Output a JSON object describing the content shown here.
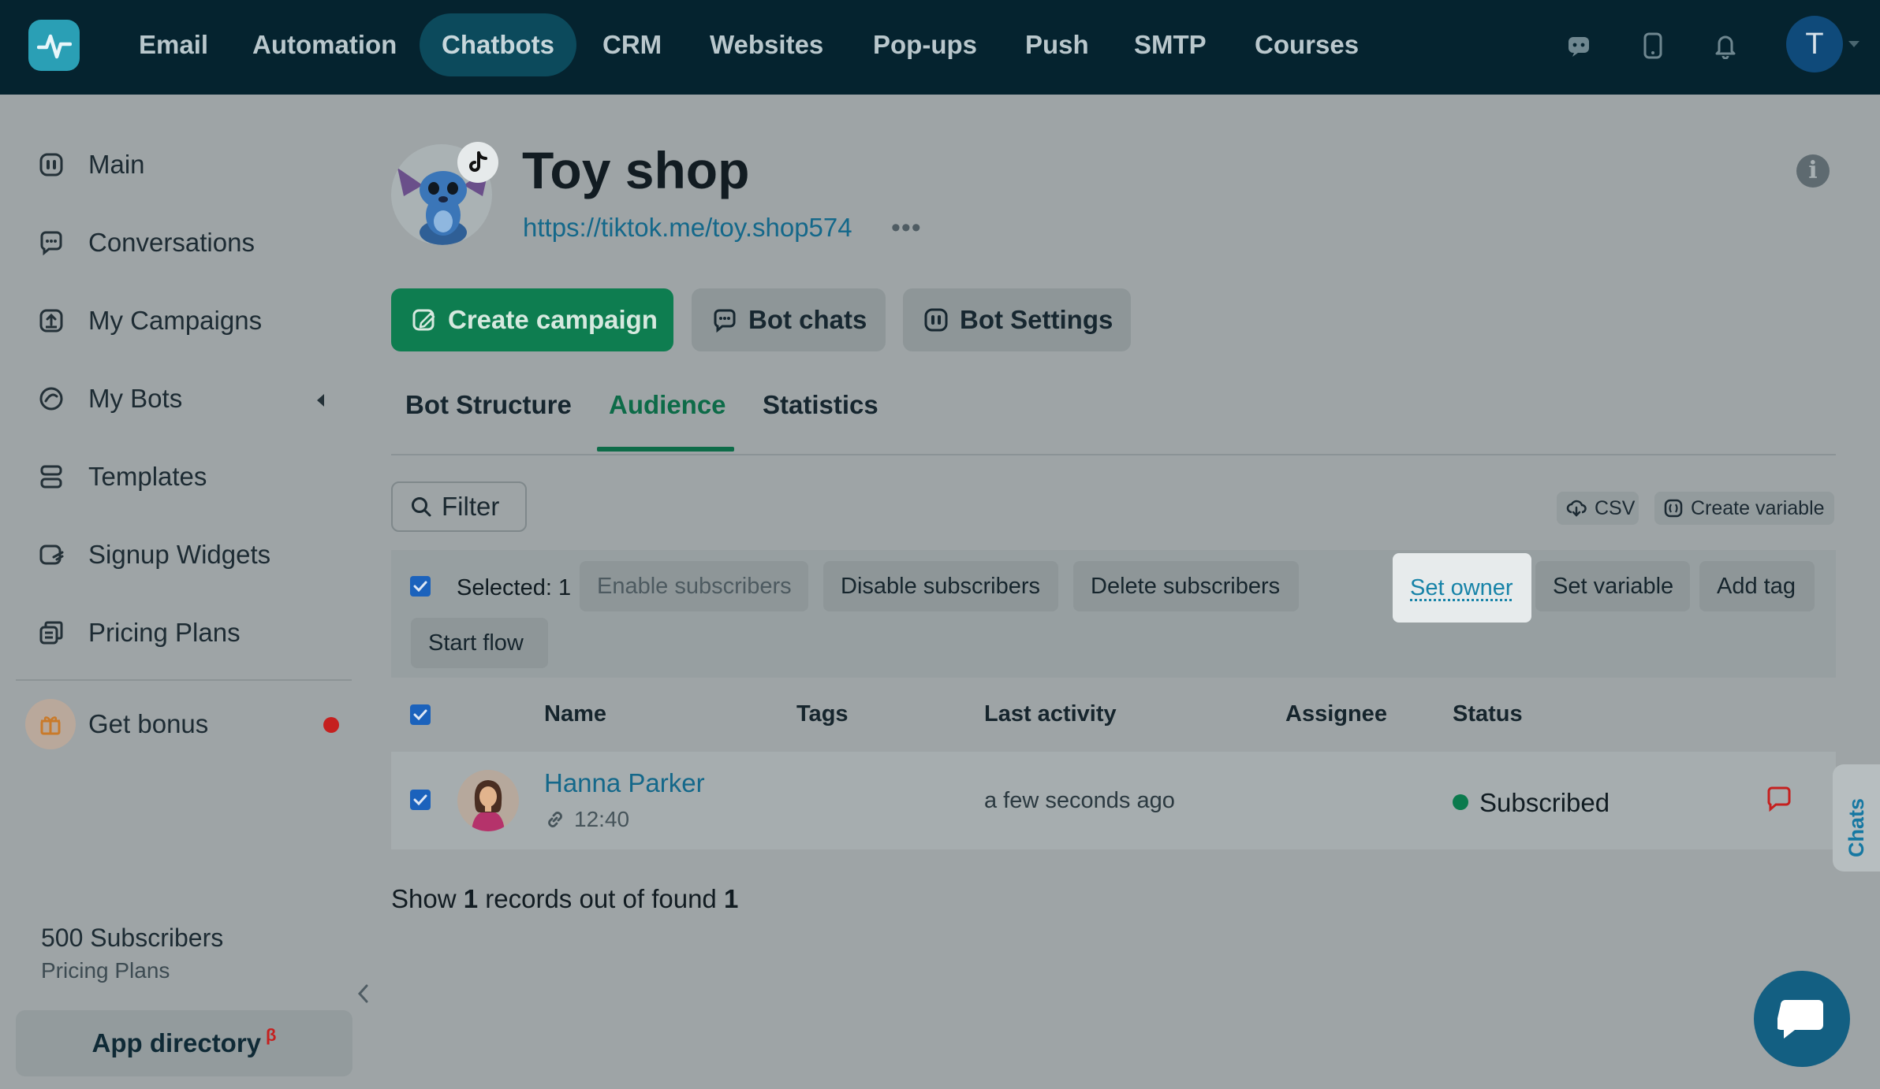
{
  "topnav": {
    "items": [
      "Email",
      "Automation",
      "Chatbots",
      "CRM",
      "Websites",
      "Pop-ups",
      "Push",
      "SMTP",
      "Courses"
    ],
    "active": "Chatbots",
    "avatar_letter": "T"
  },
  "sidebar": {
    "items": [
      {
        "label": "Main",
        "icon": "bot-icon"
      },
      {
        "label": "Conversations",
        "icon": "chat-bubble-icon"
      },
      {
        "label": "My Campaigns",
        "icon": "campaign-upload-icon"
      },
      {
        "label": "My Bots",
        "icon": "bots-icon"
      },
      {
        "label": "Templates",
        "icon": "templates-icon"
      },
      {
        "label": "Signup Widgets",
        "icon": "widget-icon"
      },
      {
        "label": "Pricing Plans",
        "icon": "pricing-icon"
      }
    ],
    "bonus_label": "Get bonus",
    "subscribers": "500 Subscribers",
    "plan_link": "Pricing Plans",
    "app_directory": "App directory",
    "beta_mark": "β"
  },
  "header": {
    "title": "Toy shop",
    "link": "https://tiktok.me/toy.shop574",
    "more": "•••"
  },
  "actions": {
    "create_campaign": "Create campaign",
    "bot_chats": "Bot chats",
    "bot_settings": "Bot Settings"
  },
  "tabs": [
    "Bot Structure",
    "Audience",
    "Statistics"
  ],
  "toolbar": {
    "filter": "Filter",
    "csv": "CSV",
    "create_variable": "Create variable"
  },
  "bulk": {
    "selected": "Selected: 1",
    "enable": "Enable subscribers",
    "disable": "Disable subscribers",
    "delete": "Delete subscribers",
    "set_owner": "Set owner",
    "set_variable": "Set variable",
    "add_tag": "Add tag",
    "start_flow": "Start flow"
  },
  "table": {
    "columns": [
      "Name",
      "Tags",
      "Last activity",
      "Assignee",
      "Status"
    ],
    "rows": [
      {
        "name": "Hanna Parker",
        "time": "12:40",
        "tags": "",
        "last_activity": "a few seconds ago",
        "assignee": "",
        "status": "Subscribed"
      }
    ]
  },
  "records": {
    "prefix": "Show",
    "shown": "1",
    "middle": "records out of found",
    "found": "1"
  },
  "chats_tab": "Chats",
  "colors": {
    "topbar": "#05232f",
    "accent_green": "#0e7d50",
    "link_blue": "#14688a",
    "checkbox_blue": "#1b62bc",
    "alert_red": "#c5201f"
  }
}
